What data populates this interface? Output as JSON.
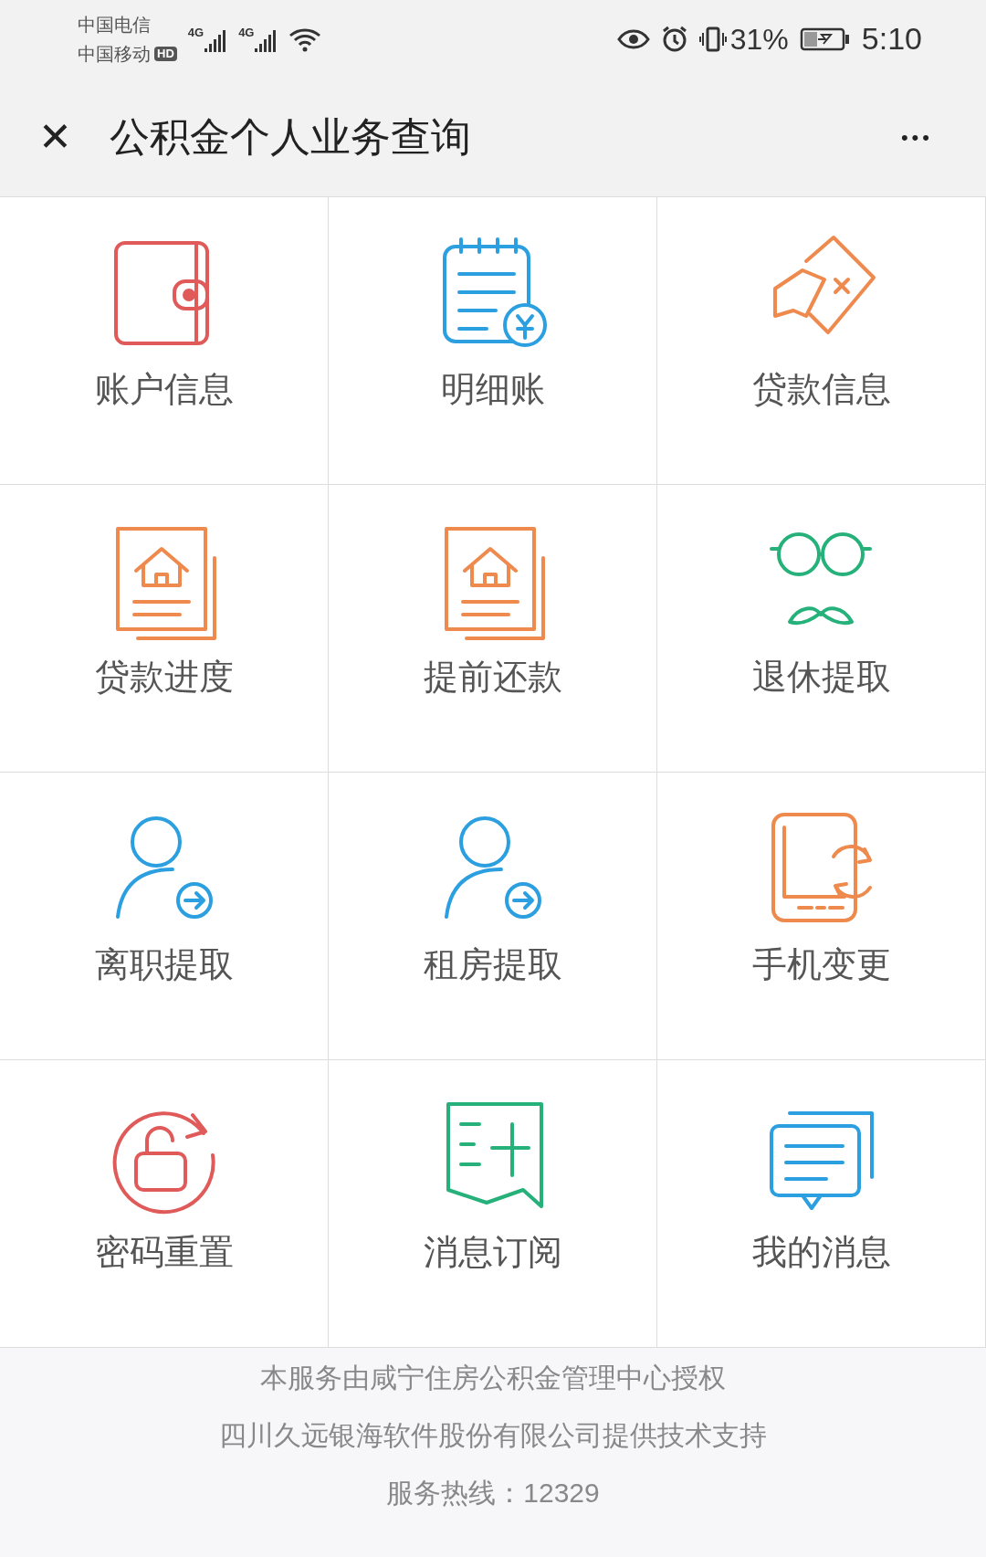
{
  "status_bar": {
    "carriers": [
      "中国电信",
      "中国移动"
    ],
    "hd_badge": "HD",
    "network_labels": [
      "4G",
      "4G"
    ],
    "battery_percent": "31%",
    "time": "5:10"
  },
  "header": {
    "close": "✕",
    "title": "公积金个人业务查询",
    "more": "•••"
  },
  "tiles": [
    {
      "label": "账户信息",
      "kind": "wallet",
      "color": "#e05a5a"
    },
    {
      "label": "明细账",
      "kind": "ledger",
      "color": "#2b9fe0"
    },
    {
      "label": "贷款信息",
      "kind": "card",
      "color": "#ee8a4e"
    },
    {
      "label": "贷款进度",
      "kind": "house",
      "color": "#ee8a4e"
    },
    {
      "label": "提前还款",
      "kind": "house",
      "color": "#ee8a4e"
    },
    {
      "label": "退休提取",
      "kind": "glasses",
      "color": "#26b07a"
    },
    {
      "label": "离职提取",
      "kind": "person",
      "color": "#2b9fe0"
    },
    {
      "label": "租房提取",
      "kind": "person",
      "color": "#2b9fe0"
    },
    {
      "label": "手机变更",
      "kind": "phone",
      "color": "#ee8a4e"
    },
    {
      "label": "密码重置",
      "kind": "lock",
      "color": "#e05a5a"
    },
    {
      "label": "消息订阅",
      "kind": "subscribe",
      "color": "#26b07a"
    },
    {
      "label": "我的消息",
      "kind": "messages",
      "color": "#2b9fe0"
    }
  ],
  "footer": [
    "本服务由咸宁住房公积金管理中心授权",
    "四川久远银海软件股份有限公司提供技术支持",
    "服务热线：12329"
  ]
}
